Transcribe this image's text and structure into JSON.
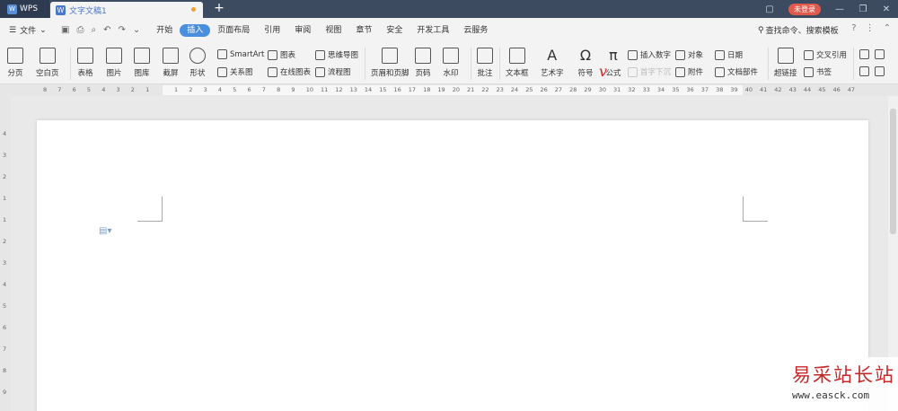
{
  "titlebar": {
    "app_tab": "WPS",
    "doc_tab": "文字文稿1",
    "new_tab": "+",
    "login": "未登录"
  },
  "menubar": {
    "file": "文件",
    "items": [
      "开始",
      "插入",
      "页面布局",
      "引用",
      "审阅",
      "视图",
      "章节",
      "安全",
      "开发工具",
      "云服务"
    ],
    "active_item": "插入",
    "search": "查找命令、搜索模板",
    "help": "?"
  },
  "ribbon": {
    "page_break": "分页",
    "blank_page": "空白页",
    "table": "表格",
    "picture": "图片",
    "gallery": "图库",
    "screenshot": "截屏",
    "shapes": "形状",
    "smartart": "SmartArt",
    "chart": "图表",
    "mindmap": "思维导图",
    "relation": "关系图",
    "online_chart": "在线图表",
    "flowchart": "流程图",
    "header_footer": "页眉和页脚",
    "page_number": "页码",
    "watermark": "水印",
    "comment": "批注",
    "textbox": "文本框",
    "wordart": "艺术字",
    "symbol": "符号",
    "formula": "公式",
    "insert_number": "插入数字",
    "first_drop": "首字下沉",
    "object": "对象",
    "attachment": "附件",
    "date": "日期",
    "doc_parts": "文档部件",
    "hyperlink": "超链接",
    "cross_ref": "交叉引用",
    "bookmark": "书签"
  },
  "ruler": {
    "top_left": [
      "8",
      "7",
      "6",
      "5",
      "4",
      "3",
      "2",
      "1"
    ],
    "top_right": [
      "1",
      "2",
      "3",
      "4",
      "5",
      "6",
      "7",
      "8",
      "9",
      "10",
      "11",
      "12",
      "13",
      "14",
      "15",
      "16",
      "17",
      "18",
      "19",
      "20",
      "21",
      "22",
      "23",
      "24",
      "25",
      "26",
      "27",
      "28",
      "29",
      "30",
      "31",
      "32",
      "33",
      "34",
      "35",
      "36",
      "37",
      "38",
      "39",
      "40",
      "41",
      "42",
      "43",
      "44",
      "45",
      "46",
      "47"
    ],
    "left": [
      "4",
      "3",
      "2",
      "1",
      "1",
      "2",
      "3",
      "4",
      "5",
      "6",
      "7",
      "8",
      "9"
    ]
  },
  "watermark": {
    "brand": "易采站长站",
    "url": "www.easck.com"
  }
}
